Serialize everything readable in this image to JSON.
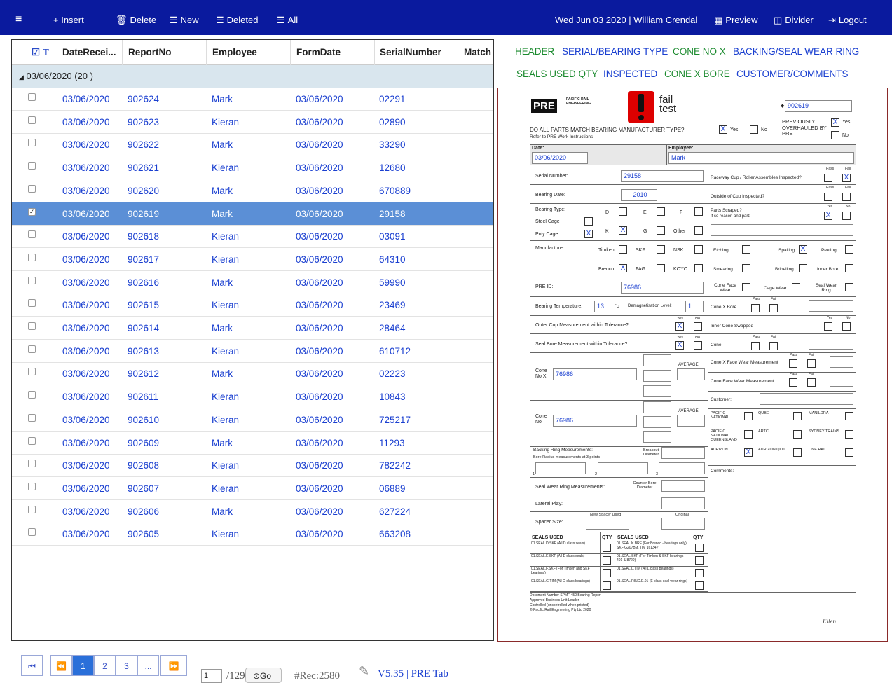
{
  "topbar": {
    "menu": "≡",
    "insert": "+ Insert",
    "delete": "Delete",
    "new": "New",
    "deleted": "Deleted",
    "all": "All",
    "datetime": "Wed Jun 03 2020 | William Crendal",
    "preview": "Preview",
    "divider": "Divider",
    "logout": "Logout"
  },
  "grid": {
    "headers": [
      "DateRecei...",
      "ReportNo",
      "Employee",
      "FormDate",
      "SerialNumber",
      "Match"
    ],
    "group": "03/06/2020 (20 )",
    "rows": [
      [
        "03/06/2020",
        "902624",
        "Mark",
        "03/06/2020",
        "02291"
      ],
      [
        "03/06/2020",
        "902623",
        "Kieran",
        "03/06/2020",
        "02890"
      ],
      [
        "03/06/2020",
        "902622",
        "Mark",
        "03/06/2020",
        "33290"
      ],
      [
        "03/06/2020",
        "902621",
        "Kieran",
        "03/06/2020",
        "12680"
      ],
      [
        "03/06/2020",
        "902620",
        "Mark",
        "03/06/2020",
        "670889"
      ],
      [
        "03/06/2020",
        "902619",
        "Mark",
        "03/06/2020",
        "29158"
      ],
      [
        "03/06/2020",
        "902618",
        "Kieran",
        "03/06/2020",
        "03091"
      ],
      [
        "03/06/2020",
        "902617",
        "Kieran",
        "03/06/2020",
        "64310"
      ],
      [
        "03/06/2020",
        "902616",
        "Mark",
        "03/06/2020",
        "59990"
      ],
      [
        "03/06/2020",
        "902615",
        "Kieran",
        "03/06/2020",
        "23469"
      ],
      [
        "03/06/2020",
        "902614",
        "Mark",
        "03/06/2020",
        "28464"
      ],
      [
        "03/06/2020",
        "902613",
        "Kieran",
        "03/06/2020",
        "610712"
      ],
      [
        "03/06/2020",
        "902612",
        "Mark",
        "03/06/2020",
        "02223"
      ],
      [
        "03/06/2020",
        "902611",
        "Kieran",
        "03/06/2020",
        "10843"
      ],
      [
        "03/06/2020",
        "902610",
        "Kieran",
        "03/06/2020",
        "725217"
      ],
      [
        "03/06/2020",
        "902609",
        "Mark",
        "03/06/2020",
        "11293"
      ],
      [
        "03/06/2020",
        "902608",
        "Kieran",
        "03/06/2020",
        "782242"
      ],
      [
        "03/06/2020",
        "902607",
        "Kieran",
        "03/06/2020",
        "06889"
      ],
      [
        "03/06/2020",
        "902606",
        "Mark",
        "03/06/2020",
        "627224"
      ],
      [
        "03/06/2020",
        "902605",
        "Kieran",
        "03/06/2020",
        "663208"
      ]
    ],
    "selected_index": 5
  },
  "pager": {
    "first": "⏮",
    "prev": "⏪",
    "pages": [
      "1",
      "2",
      "3",
      "..."
    ],
    "next": "⏩",
    "page_input": "1",
    "total_pages": "/129",
    "go": "⊙Go",
    "records": "#Rec:2580",
    "version": "V5.35 | PRE Tab"
  },
  "tabs": [
    "HEADER",
    "SERIAL/BEARING TYPE",
    "CONE NO X",
    "BACKING/SEAL WEAR RING",
    "SEALS USED QTY",
    "INSPECTED",
    "CONE X BORE",
    "CUSTOMER/COMMENTS"
  ],
  "form": {
    "logo_pre": "PRE",
    "logo_pre_sub": "PACIFIC RAIL ENGINEERING",
    "logo_fail": "fail",
    "logo_test": "test",
    "report_no": "902619",
    "q_match": "DO ALL PARTS MATCH BEARING MANUFACTURER TYPE?",
    "q_match_sub": "Refer to PRE Work Instructions",
    "yes": "Yes",
    "no": "No",
    "prev_overhauled": "PREVIOUSLY OVERHAULED BY PRE",
    "date_label": "Date:",
    "date": "03/06/2020",
    "employee_label": "Employee:",
    "employee": "Mark",
    "serial_label": "Serial Number:",
    "serial": "29158",
    "bearing_date_label": "Bearing Date:",
    "bearing_date": "2010",
    "bearing_type_label": "Bearing Type:",
    "steel_cage": "Steel Cage",
    "poly_cage": "Poly Cage",
    "types": [
      "D",
      "E",
      "F",
      "K",
      "G",
      "Other"
    ],
    "manufacturer_label": "Manufacturer:",
    "manufacturers": [
      "Timken",
      "SKF",
      "NSK",
      "Brenco",
      "FAG",
      "KOYO"
    ],
    "pre_id_label": "PRE ID:",
    "pre_id": "76986",
    "bearing_temp_label": "Bearing Temperature:",
    "bearing_temp": "13",
    "temp_unit": "°c",
    "demag_label": "Demagnetisation Level:",
    "demag": "1",
    "outer_cup_label": "Outer Cup Measurement within Tolerance?",
    "seal_bore_label": "Seal Bore Measurement within Tolerance?",
    "cone_no_x_label": "Cone No X",
    "cone_no_x": "76986",
    "average": "AVERAGE",
    "cone_no_label": "Cone No",
    "cone_no": "76986",
    "backing_label": "Backing Ring Measurements:",
    "bore_radius_label": "Bore Radius measurements at 3 points",
    "breakout_label": "Breakout Diameter",
    "p1": "1",
    "p2": "2",
    "p3": "3",
    "seal_wear_label": "Seal Wear Ring Measurements:",
    "counter_bore_label": "Counter-Bore Diameter",
    "lateral_label": "Lateral Play:",
    "spacer_label": "Spacer Size:",
    "new_spacer_label": "New Spacer Used",
    "original_label": "Original",
    "raceway_label": "Raceway Cup / Roller Assembles Inspected?",
    "outside_cup_label": "Outside of Cup Inspected?",
    "parts_scraped_label": "Parts Scraped?",
    "parts_scraped_sub": "If so reason and part:",
    "pass": "Pass",
    "fail": "Fail",
    "defects": [
      "Etching",
      "Spalling",
      "Peeling",
      "Smearing",
      "Brinelling",
      "Inner Bore"
    ],
    "cone_face_wear": "Cone Face Wear",
    "cage_wear": "Cage Wear",
    "seal_wear_ring": "Seal Wear Ring",
    "cone_x_bore": "Cone X Bore",
    "inner_cone_swapped": "Inner Cone Swapped",
    "cone": "Cone",
    "cone_x_face_meas": "Cone X Face Wear Measurement",
    "cone_face_meas": "Cone Face Wear Measurement",
    "customer_label": "Customer:",
    "customers": [
      "PACIFIC NATIONAL",
      "QUBE",
      "MANILDRA",
      "PACIFIC NATIONAL QUEENSLAND",
      "ARTC",
      "SYDNEY TRAINS",
      "AURIZON",
      "AURIZON QLD",
      "ONE RAIL"
    ],
    "comments_label": "Comments:",
    "seals_header": "SEALS USED",
    "qty_header": "QTY",
    "seals_left": [
      "01.SEAL.D.SKF (All D class seals)",
      "01.SEAL.E.SKF (All E class seals)",
      "01.SEAL.F.SKF (For Timken and SKF bearings)",
      "01.SEAL.G.TIM (All G class bearings)"
    ],
    "seals_right": [
      "01.SEAL.K.BRE (For Brenco - bearings only) SKF G207B & TIM 16134?",
      "01.SEAL.SKF (For Timken & SKF bearings 401 & 8720)",
      "01.SEAL.L.TIM (All L class bearings)",
      "01.SEAL.RING.E.01 (E class seal wear rings)"
    ],
    "footer": [
      "Document Number SPMF 450 Bearing Report",
      "Approved Business Unit Leader",
      "Controlled (uncontrolled when printed)",
      "© Pacific Rail Engineering Pty Ltd 2020"
    ],
    "signature": "Ellen"
  }
}
